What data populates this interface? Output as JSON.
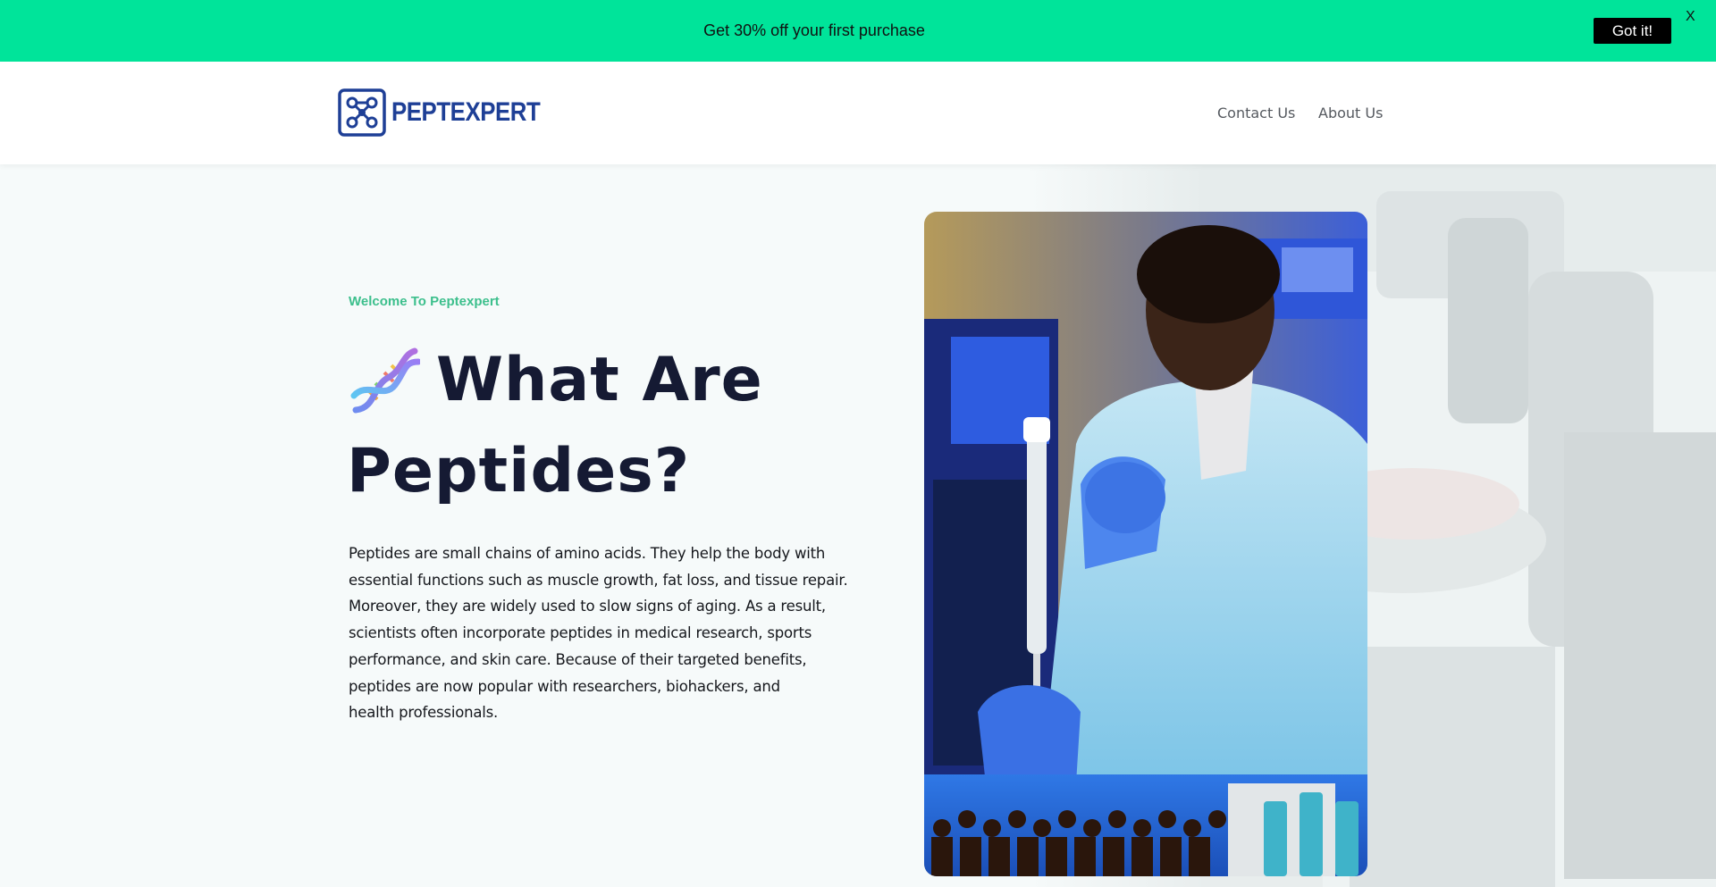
{
  "promo": {
    "text": "Get 30% off your first purchase",
    "button_label": "Got it!",
    "close_label": "X",
    "background": "#00e49a"
  },
  "header": {
    "logo_text": "PEPTEXPERT",
    "brand_color": "#1e3f96",
    "nav": [
      {
        "label": "Contact Us"
      },
      {
        "label": "About Us"
      }
    ]
  },
  "hero": {
    "eyebrow": "Welcome To Peptexpert",
    "eyebrow_color": "#3cbf8c",
    "title_line1": "What Are",
    "title_line2": "Peptides?",
    "description_lines": [
      "Peptides are small chains of amino acids. They help the body with",
      "essential functions such as muscle growth, fat loss, and tissue repair.",
      "Moreover, they are widely used to slow signs of aging. As a result,",
      "scientists often incorporate peptides in medical research, sports",
      "performance, and skin care. Because of their targeted benefits,",
      "peptides are now popular with researchers, biohackers, and",
      "health professionals."
    ],
    "icon": "dna-icon"
  }
}
